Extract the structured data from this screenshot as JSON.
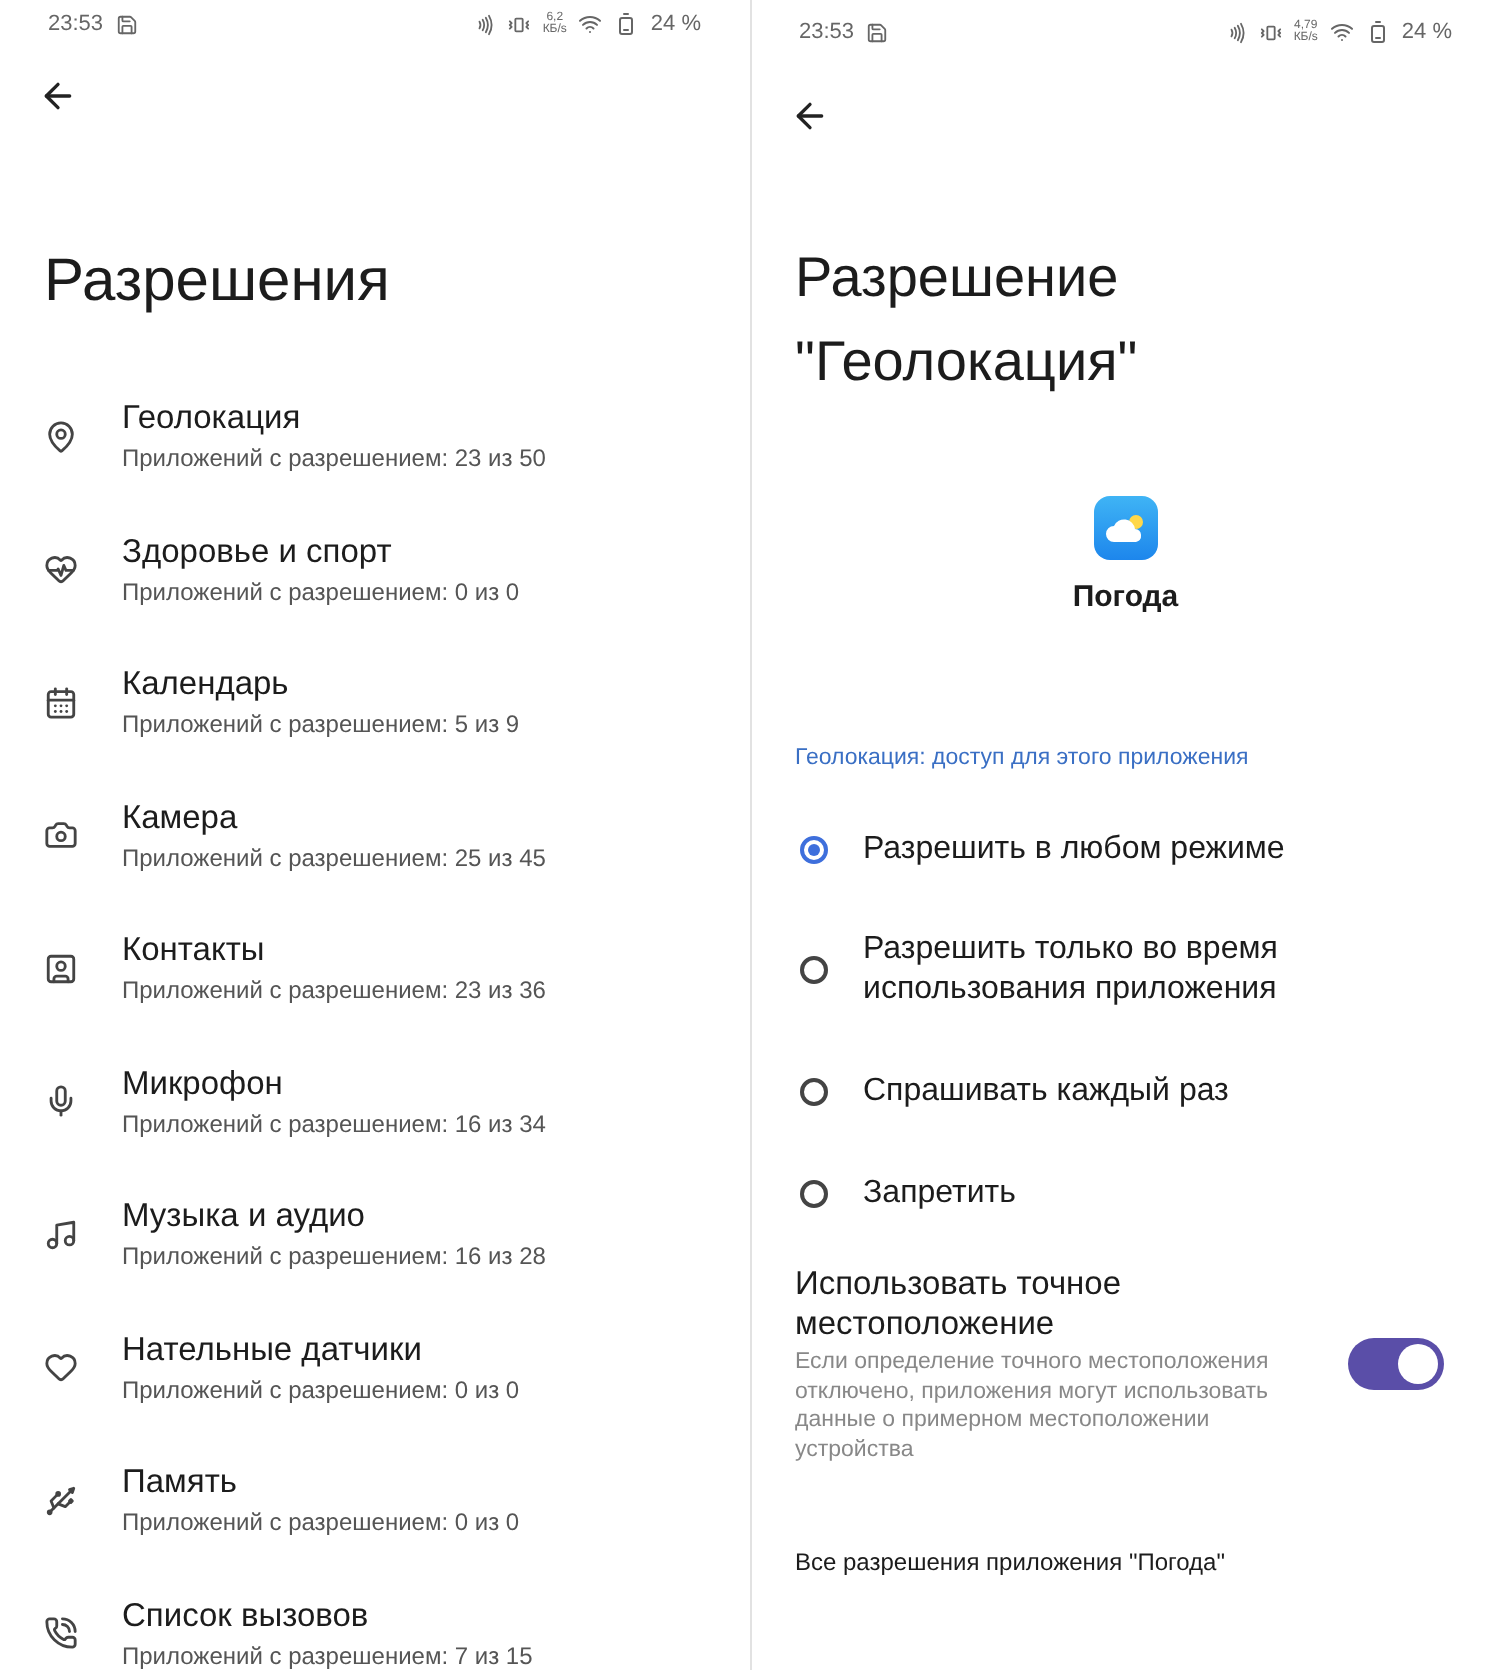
{
  "screens": [
    {
      "status_bar": {
        "time": "23:53",
        "speed_value": "6,2",
        "speed_unit": "КБ/s",
        "battery": "24 %"
      },
      "title": "Разрешения",
      "permissions": [
        {
          "kind": "location",
          "name": "Геолокация",
          "summary": "Приложений с разрешением: 23 из 50"
        },
        {
          "kind": "health",
          "name": "Здоровье и спорт",
          "summary": "Приложений с разрешением: 0 из 0"
        },
        {
          "kind": "calendar",
          "name": "Календарь",
          "summary": "Приложений с разрешением: 5 из 9"
        },
        {
          "kind": "camera",
          "name": "Камера",
          "summary": "Приложений с разрешением: 25 из 45"
        },
        {
          "kind": "contacts",
          "name": "Контакты",
          "summary": "Приложений с разрешением: 23 из 36"
        },
        {
          "kind": "microphone",
          "name": "Микрофон",
          "summary": "Приложений с разрешением: 16 из 34"
        },
        {
          "kind": "music",
          "name": "Музыка и аудио",
          "summary": "Приложений с разрешением: 16 из 28"
        },
        {
          "kind": "sensors",
          "name": "Нательные датчики",
          "summary": "Приложений с разрешением: 0 из 0"
        },
        {
          "kind": "storage",
          "name": "Память",
          "summary": "Приложений с разрешением: 0 из 0"
        },
        {
          "kind": "calls",
          "name": "Список вызовов",
          "summary": "Приложений с разрешением: 7 из 15"
        }
      ]
    },
    {
      "status_bar": {
        "time": "23:53",
        "speed_value": "4,79",
        "speed_unit": "КБ/s",
        "battery": "24 %"
      },
      "title": "Разрешение \"Геолокация\"",
      "app": {
        "name": "Погода"
      },
      "section_header": "Геолокация: доступ для этого приложения",
      "options": [
        {
          "label": "Разрешить в любом режиме",
          "selected": true
        },
        {
          "label": "Разрешить только во время использования приложения",
          "selected": false
        },
        {
          "label": "Спрашивать каждый раз",
          "selected": false
        },
        {
          "label": "Запретить",
          "selected": false
        }
      ],
      "precise_location": {
        "title": "Использовать точное местоположение",
        "description": "Если определение точного местоположения отключено, приложения могут использовать данные о примерном местоположении устройства",
        "on": true
      },
      "footer_link": "Все разрешения приложения \"Погода\""
    }
  ]
}
